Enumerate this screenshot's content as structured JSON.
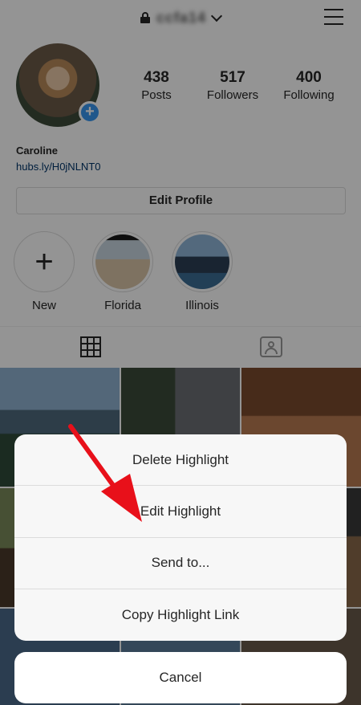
{
  "header": {
    "username": "ccfa14",
    "lock_icon": "lock-icon",
    "menu_icon": "hamburger-menu-icon"
  },
  "profile": {
    "stats": [
      {
        "value": "438",
        "label": "Posts"
      },
      {
        "value": "517",
        "label": "Followers"
      },
      {
        "value": "400",
        "label": "Following"
      }
    ],
    "name": "Caroline",
    "link": "hubs.ly/H0jNLNT0",
    "edit_button": "Edit Profile",
    "add_icon": "+"
  },
  "highlights": [
    {
      "label": "New",
      "icon": "+"
    },
    {
      "label": "Florida"
    },
    {
      "label": "Illinois"
    }
  ],
  "tabs": {
    "grid_icon": "grid-icon",
    "tagged_icon": "tagged-icon"
  },
  "action_sheet": {
    "options": [
      "Delete Highlight",
      "Edit Highlight",
      "Send to...",
      "Copy Highlight Link"
    ],
    "cancel": "Cancel"
  },
  "colors": {
    "accent_blue": "#3897f0",
    "link_color": "#003569",
    "arrow_red": "#e8101a"
  }
}
